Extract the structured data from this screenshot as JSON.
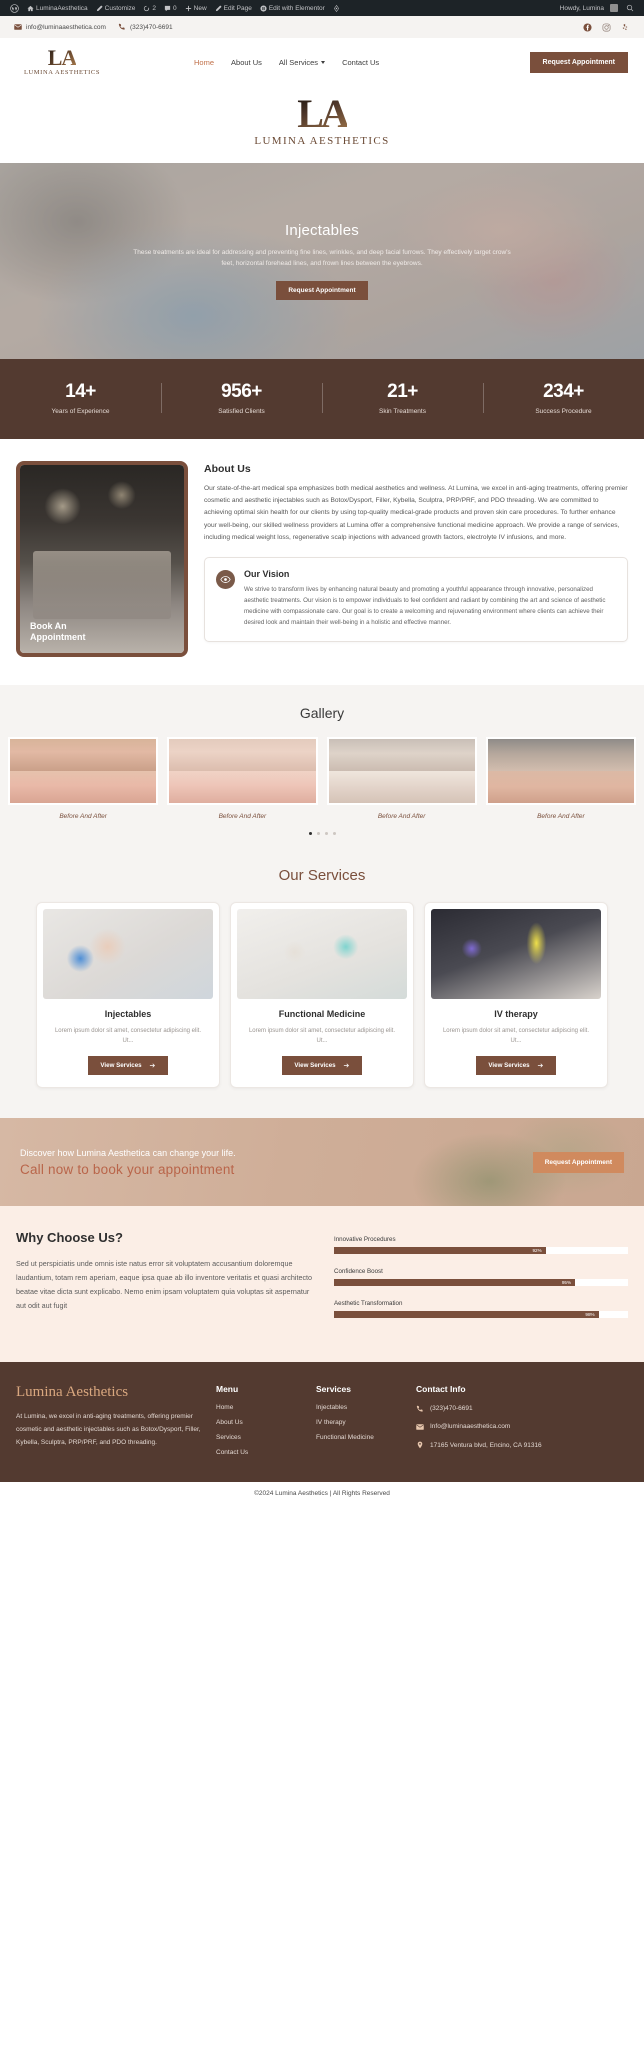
{
  "admin_bar": {
    "items": [
      {
        "icon": "wordpress-icon",
        "label": ""
      },
      {
        "icon": "home-icon",
        "label": "LuminaAesthetica"
      },
      {
        "icon": "pencil-icon",
        "label": "Customize"
      },
      {
        "icon": "refresh-icon",
        "label": "2"
      },
      {
        "icon": "comment-icon",
        "label": "0"
      },
      {
        "icon": "plus-icon",
        "label": "New"
      },
      {
        "icon": "pencil-icon",
        "label": "Edit Page"
      },
      {
        "icon": "elementor-icon",
        "label": "Edit with Elementor"
      },
      {
        "icon": "diamond-icon",
        "label": ""
      }
    ],
    "greeting": "Howdy, Lumina",
    "search_icon": "search-icon"
  },
  "topbar": {
    "email": "info@luminaaesthetica.com",
    "phone": "(323)470-6691",
    "email_icon": "envelope-icon",
    "phone_icon": "phone-icon",
    "socials": [
      "facebook-icon",
      "instagram-icon",
      "yelp-icon"
    ]
  },
  "header": {
    "logo_mark": "LA",
    "logo_name": "LUMINA AESTHETICS",
    "nav": [
      {
        "label": "Home",
        "active": true,
        "dropdown": false
      },
      {
        "label": "About Us",
        "active": false,
        "dropdown": false
      },
      {
        "label": "All Services",
        "active": false,
        "dropdown": true
      },
      {
        "label": "Contact Us",
        "active": false,
        "dropdown": false
      }
    ],
    "cta_label": "Request Appointment"
  },
  "big_logo": {
    "mark": "LA",
    "name": "LUMINA AESTHETICS"
  },
  "hero": {
    "title": "Injectables",
    "subtitle": "These treatments are ideal for addressing and preventing fine lines, wrinkles, and deep facial furrows. They effectively target crow's feet, horizontal forehead lines, and frown lines between the eyebrows.",
    "button": "Request Appointment"
  },
  "stats": [
    {
      "value": "14+",
      "label": "Years of Experience"
    },
    {
      "value": "956+",
      "label": "Satisfied Clients"
    },
    {
      "value": "21+",
      "label": "Skin Treatments"
    },
    {
      "value": "234+",
      "label": "Success Procedure"
    }
  ],
  "about": {
    "photo_caption": "Book An\nAppointment",
    "heading": "About Us",
    "body": "Our state-of-the-art medical spa emphasizes both medical aesthetics and wellness. At Lumina, we excel in anti-aging treatments, offering premier cosmetic and aesthetic injectables such as Botox/Dysport, Filler, Kybella, Sculptra, PRP/PRF, and PDO threading. We are committed to achieving optimal skin health for our clients by using top-quality medical-grade products and proven skin care procedures. To further enhance your well-being, our skilled wellness providers at Lumina offer a comprehensive functional medicine approach. We provide a range of services, including medical weight loss, regenerative scalp injections with advanced growth factors, electrolyte IV infusions, and more.",
    "vision_icon": "eye-icon",
    "vision_heading": "Our Vision",
    "vision_body": "We strive to transform lives by enhancing natural beauty and promoting a youthful appearance through innovative, personalized aesthetic treatments. Our vision is to empower individuals to feel confident and radiant by combining the art and science of aesthetic medicine with compassionate care. Our goal is to create a welcoming and rejuvenating environment where clients can achieve their desired look and maintain their well-being in a holistic and effective manner."
  },
  "gallery": {
    "heading": "Gallery",
    "items": [
      {
        "caption": "Before And After"
      },
      {
        "caption": "Before And After"
      },
      {
        "caption": "Before And After"
      },
      {
        "caption": "Before And After"
      }
    ],
    "dots": 4,
    "active_dot": 0
  },
  "services": {
    "heading": "Our Services",
    "cards": [
      {
        "title": "Injectables",
        "desc": "Lorem ipsum dolor sit amet, consectetur adipiscing elit. Ut...",
        "button": "View Services"
      },
      {
        "title": "Functional Medicine",
        "desc": "Lorem ipsum dolor sit amet, consectetur adipiscing elit. Ut...",
        "button": "View Services"
      },
      {
        "title": "IV therapy",
        "desc": "Lorem ipsum dolor sit amet, consectetur adipiscing elit. Ut...",
        "button": "View Services"
      }
    ]
  },
  "cta": {
    "line1": "Discover how Lumina Aesthetica can change your life.",
    "line2": "Call now to book your appointment",
    "button": "Request Appointment"
  },
  "why": {
    "heading": "Why Choose Us?",
    "body": "Sed ut perspiciatis unde omnis iste natus error sit voluptatem accusantium doloremque laudantium, totam rem aperiam, eaque ipsa quae ab illo inventore veritatis et quasi architecto beatae vitae dicta sunt explicabo. Nemo enim ipsam voluptatem quia voluptas sit aspernatur aut odit aut fugit",
    "bars": [
      {
        "label": "Innovative Procedures",
        "value": "92%",
        "pct": 72
      },
      {
        "label": "Confidence Boost",
        "value": "95%",
        "pct": 82
      },
      {
        "label": "Aesthetic Transformation",
        "value": "98%",
        "pct": 90
      }
    ]
  },
  "footer": {
    "brand": "Lumina Aesthetics",
    "brand_text": "At Lumina, we excel in anti-aging treatments, offering premier cosmetic and aesthetic injectables such as Botox/Dysport, Filler, Kybella, Sculptra, PRP/PRF, and PDO threading.",
    "menu_heading": "Menu",
    "menu_links": [
      "Home",
      "About Us",
      "Services",
      "Contact Us"
    ],
    "services_heading": "Services",
    "services_links": [
      "Injectables",
      "IV therapy",
      "Functional Medicine"
    ],
    "contact_heading": "Contact Info",
    "contacts": [
      {
        "icon": "phone-icon",
        "text": "(323)470-6691"
      },
      {
        "icon": "envelope-icon",
        "text": "Info@luminaaesthetica.com"
      },
      {
        "icon": "pin-icon",
        "text": "17165 Ventura blvd, Encino, CA 91316"
      }
    ],
    "copyright": "©2024 Lumina Aesthetics | All Rights Reserved"
  },
  "colors": {
    "brand_brown": "#7a4f3c",
    "dark_brown": "#533a30",
    "accent_orange": "#c1714a",
    "cta_orange": "#d08a5e",
    "footer_gold": "#d9a77f"
  }
}
